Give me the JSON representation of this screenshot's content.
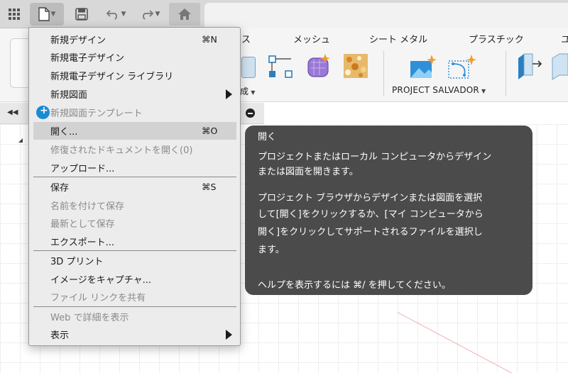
{
  "ribbon": {
    "tabs": [
      "ス",
      "メッシュ",
      "シート メタル",
      "プラスチック",
      "ユ"
    ],
    "label_partial": "成",
    "group_label": "PROJECT SALVADOR"
  },
  "menu": {
    "items": [
      {
        "label": "新規デザイン",
        "shortcut": "⌘N"
      },
      {
        "label": "新規電子デザイン"
      },
      {
        "label": "新規電子デザイン ライブラリ"
      },
      {
        "label": "新規図面"
      },
      {
        "label": "新規図面テンプレート"
      },
      {
        "label": "開く...",
        "shortcut": "⌘O"
      },
      {
        "label": "修復されたドキュメントを開く(0)"
      },
      {
        "label": "アップロード..."
      },
      {
        "label": "保存",
        "shortcut": "⌘S"
      },
      {
        "label": "名前を付けて保存"
      },
      {
        "label": "最新として保存"
      },
      {
        "label": "エクスポート..."
      },
      {
        "label": "3D プリント"
      },
      {
        "label": "イメージをキャプチャ..."
      },
      {
        "label": "ファイル リンクを共有"
      },
      {
        "label": "Web で詳細を表示"
      },
      {
        "label": "表示"
      }
    ]
  },
  "tooltip": {
    "title": "開く",
    "line1": "プロジェクトまたはローカル コンピュータからデザイン",
    "line2": "または図面を開きます。",
    "line3": "プロジェクト ブラウザからデザインまたは図面を選択",
    "line4": "して[開く]をクリックするか、[マイ コンピュータから",
    "line5": "開く]をクリックしてサポートされるファイルを選択し",
    "line6": "ます。",
    "help": "ヘルプを表示するには ⌘/ を押してください。"
  },
  "colors": {
    "menu_bg": "#ececec",
    "menu_highlight": "#d2d2d2",
    "tooltip_bg": "#4b4b4b",
    "accent_blue": "#1a8bd6"
  },
  "icons": [
    "apps-grid-icon",
    "file-icon",
    "save-icon",
    "undo-icon",
    "redo-icon",
    "home-icon",
    "submenu-arrow-icon",
    "template-badge-icon"
  ]
}
